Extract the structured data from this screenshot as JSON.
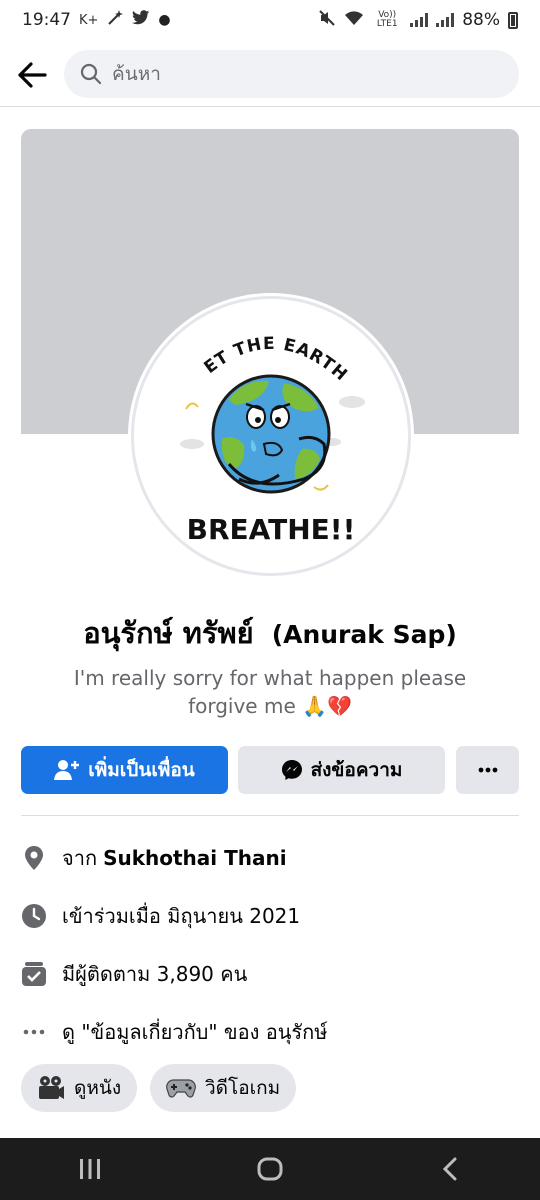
{
  "status_bar": {
    "time": "19:47",
    "left_icons": [
      "k-plus-icon",
      "magic-wand-icon",
      "twitter-icon",
      "dot-icon"
    ],
    "carrier_label": "Vo)) LTE1",
    "battery": "88%"
  },
  "search": {
    "placeholder": "ค้นหา"
  },
  "profile": {
    "avatar_top_text": "LET THE EARTH",
    "avatar_bottom_text": "BREATHE!!",
    "name_thai": "อนุรักษ์ ทรัพย์",
    "name_latin": "(Anurak Sap)",
    "bio_line1": "I'm really sorry for what happen please",
    "bio_line2": "forgive me 🙏💔"
  },
  "actions": {
    "add_friend": "เพิ่มเป็นเพื่อน",
    "message": "ส่งข้อความ",
    "more": "more-icon"
  },
  "info": {
    "from_prefix": "จาก",
    "from_place": "Sukhothai Thani",
    "joined": "เข้าร่วมเมื่อ มิถุนายน  2021",
    "followers": "มีผู้ติดตาม 3,890 คน",
    "about": "ดู \"ข้อมูลเกี่ยวกับ\" ของ อนุรักษ์"
  },
  "chips": [
    {
      "label": "ดูหนัง",
      "icon": "projector-icon"
    },
    {
      "label": "วิดีโอเกม",
      "icon": "gamepad-icon"
    }
  ],
  "nav": [
    "recent-apps-icon",
    "home-icon",
    "back-icon"
  ],
  "colors": {
    "primary": "#1b74e4",
    "secondary_btn": "#e4e6eb",
    "cover": "#ccced2",
    "text_muted": "#65676b"
  }
}
